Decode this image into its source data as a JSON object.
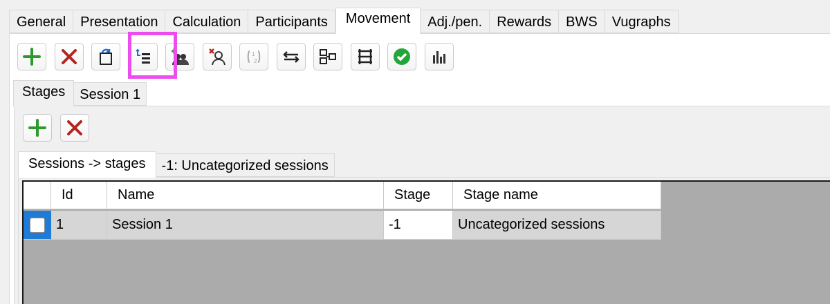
{
  "top_tabs": [
    "General",
    "Presentation",
    "Calculation",
    "Participants",
    "Movement",
    "Adj./pen.",
    "Rewards",
    "BWS",
    "Vugraphs"
  ],
  "active_top_tab": "Movement",
  "toolbar_icons": [
    "add-icon",
    "delete-icon",
    "refresh-icon",
    "session-stages-icon",
    "add-players-icon",
    "remove-player-icon",
    "swap-rounds-icon",
    "swap-icon",
    "move-to-icon",
    "table-lines-icon",
    "check-icon",
    "stats-icon"
  ],
  "inner_tabs": [
    "Stages",
    "Session 1"
  ],
  "stage_toolbar_icons": [
    "add-icon",
    "delete-icon"
  ],
  "sub_tabs": [
    "Sessions -> stages",
    "-1: Uncategorized sessions"
  ],
  "grid": {
    "columns": [
      "Id",
      "Name",
      "Stage",
      "Stage name"
    ],
    "rows": [
      {
        "id": "1",
        "name": "Session 1",
        "stage": "-1",
        "stage_name": "Uncategorized sessions"
      }
    ]
  },
  "colors": {
    "highlight": "#ee4dee",
    "add_green": "#2e9a2e",
    "delete_red": "#b3261e",
    "check_green": "#22a63a",
    "selection_blue": "#1e7bd6"
  }
}
